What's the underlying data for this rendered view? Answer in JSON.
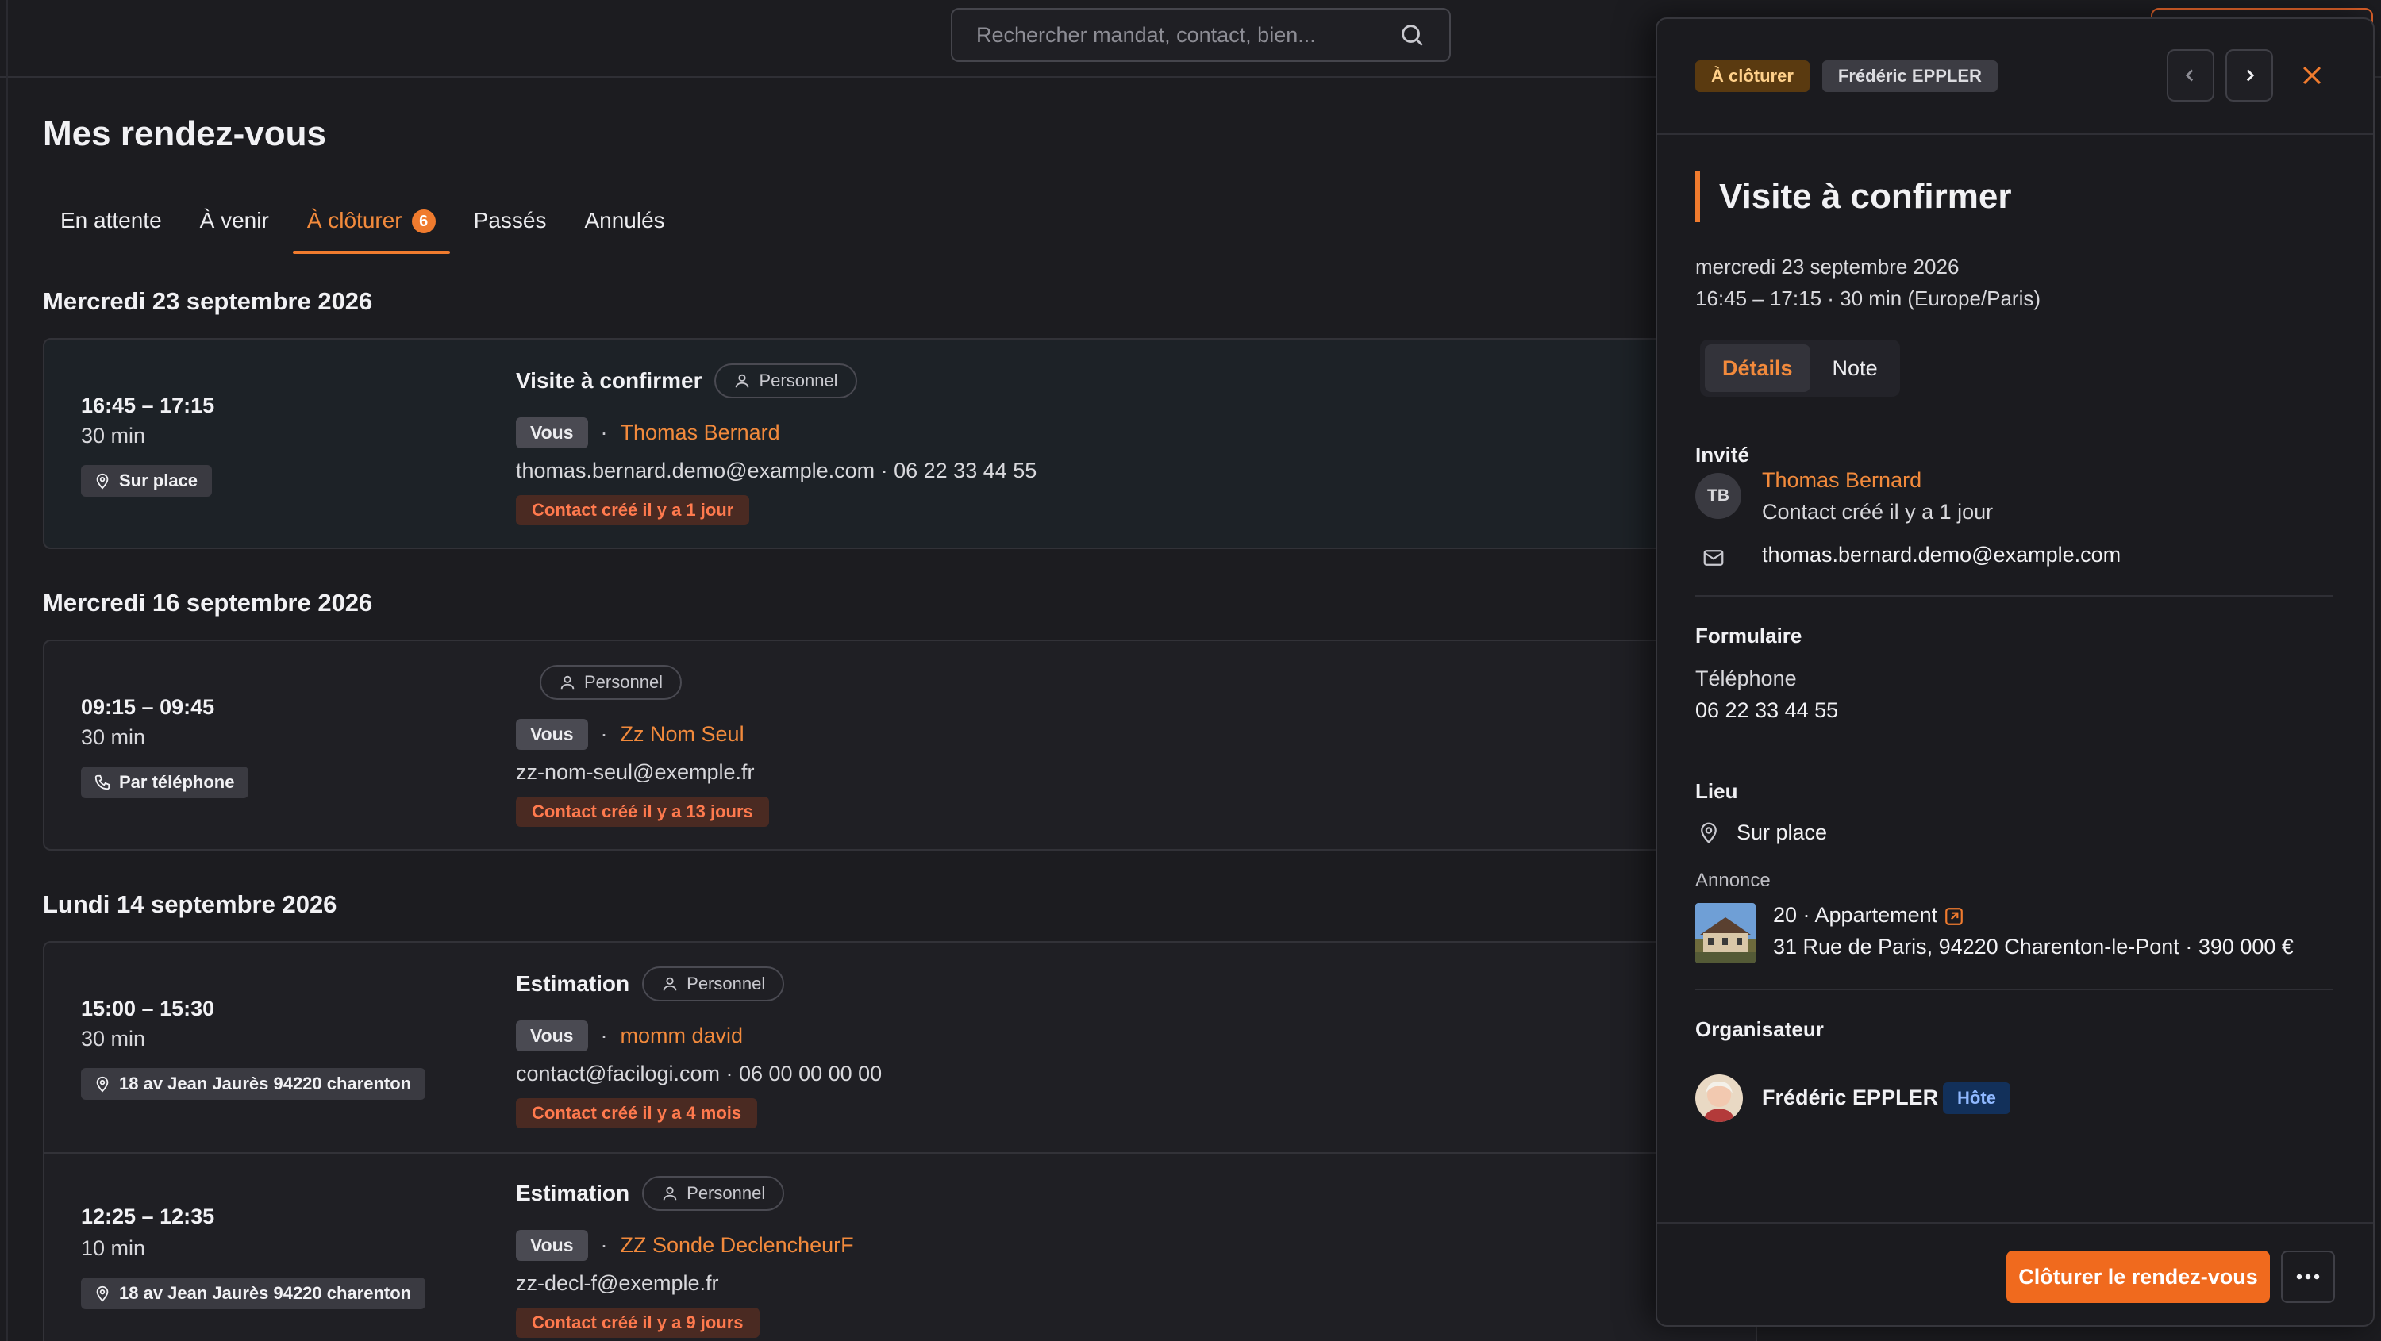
{
  "search": {
    "placeholder": "Rechercher mandat, contact, bien..."
  },
  "page": {
    "title": "Mes rendez-vous"
  },
  "tabs": [
    {
      "label": "En attente"
    },
    {
      "label": "À venir"
    },
    {
      "label": "À clôturer",
      "count": "6"
    },
    {
      "label": "Passés"
    },
    {
      "label": "Annulés"
    }
  ],
  "days": [
    {
      "label": "Mercredi 23 septembre 2026"
    },
    {
      "label": "Mercredi 16 septembre 2026"
    },
    {
      "label": "Lundi 14 septembre 2026"
    }
  ],
  "appointments": [
    {
      "time": "16:45 – 17:15",
      "duration": "30 min",
      "location": "Sur place",
      "location_icon": "map-pin-icon",
      "title": "Visite à confirmer",
      "scope": "Personnel",
      "you": "Vous",
      "sep": "·",
      "contact": "Thomas Bernard",
      "details": "thomas.bernard.demo@example.com · 06 22 33 44 55",
      "badge": "Contact créé il y a 1 jour"
    },
    {
      "time": "09:15 – 09:45",
      "duration": "30 min",
      "location": "Par téléphone",
      "location_icon": "phone-icon",
      "title": "",
      "scope": "Personnel",
      "you": "Vous",
      "sep": "·",
      "contact": "Zz Nom Seul",
      "details": "zz-nom-seul@exemple.fr",
      "badge": "Contact créé il y a 13 jours"
    },
    {
      "time": "15:00 – 15:30",
      "duration": "30 min",
      "location": "18 av Jean Jaurès 94220 charenton",
      "location_icon": "map-pin-icon",
      "title": "Estimation",
      "scope": "Personnel",
      "you": "Vous",
      "sep": "·",
      "contact": "momm david",
      "details": "contact@facilogi.com · 06 00 00 00 00",
      "badge": "Contact créé il y a 4 mois"
    },
    {
      "time": "12:25 – 12:35",
      "duration": "10 min",
      "location": "18 av Jean Jaurès 94220 charenton",
      "location_icon": "map-pin-icon",
      "title": "Estimation",
      "scope": "Personnel",
      "you": "Vous",
      "sep": "·",
      "contact": "ZZ Sonde DeclencheurF",
      "details": "zz-decl-f@exemple.fr",
      "badge": "Contact créé il y a 9 jours"
    }
  ],
  "panel": {
    "status_tag": "À clôturer",
    "agent_tag": "Frédéric EPPLER",
    "title": "Visite à confirmer",
    "date": "mercredi 23 septembre 2026",
    "time": "16:45 – 17:15 · 30 min (Europe/Paris)",
    "tabs": [
      "Détails",
      "Note"
    ],
    "invite": {
      "heading": "Invité",
      "initials": "TB",
      "name": "Thomas Bernard",
      "sub": "Contact créé il y a 1 jour",
      "email": "thomas.bernard.demo@example.com"
    },
    "form": {
      "heading": "Formulaire",
      "label": "Téléphone",
      "value": "06 22 33 44 55"
    },
    "place": {
      "heading": "Lieu",
      "value": "Sur place",
      "listing_label": "Annonce",
      "listing_title": "20 · Appartement",
      "listing_address": "31 Rue de Paris, 94220 Charenton-le-Pont · 390 000 €"
    },
    "organizer": {
      "heading": "Organisateur",
      "name": "Frédéric EPPLER",
      "role": "Hôte"
    },
    "cta": "Clôturer le rendez-vous"
  },
  "colors": {
    "accent": "#f07b2e",
    "background": "#1c1c20",
    "badge_red": "#ff7a4e",
    "host_badge": "#8fb8ff"
  }
}
